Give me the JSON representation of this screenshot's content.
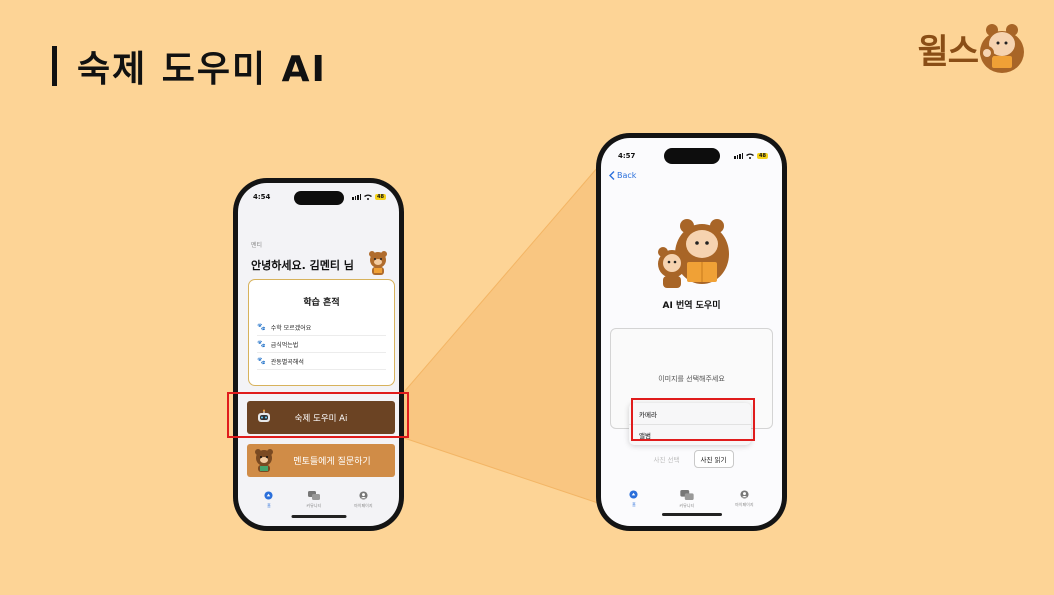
{
  "slide": {
    "title": "숙제 도우미 AI",
    "logo_text": "윌스"
  },
  "phone1": {
    "time": "4:54",
    "battery": "48",
    "greeting_sub": "멘티",
    "greeting": "안녕하세요. 김멘티 님",
    "history": {
      "title": "학습 흔적",
      "items": [
        "수학 모르겠어요",
        "급식먹는법",
        "관동별곡해석"
      ]
    },
    "homework_button": "숙제 도우미 Ai",
    "mentor_button": "멘토들에게 질문하기",
    "tabs": [
      "홈",
      "커뮤니티",
      "마이페이지"
    ]
  },
  "phone2": {
    "time": "4:57",
    "battery": "48",
    "back": "Back",
    "title": "AI 번역 도우미",
    "upload_prompt": "이미지를 선택해주세요",
    "menu": [
      "카메라",
      "앨범"
    ],
    "select_photo": "사진 선택",
    "read_photo": "사진 읽기",
    "tabs": [
      "홈",
      "커뮤니티",
      "마이페이지"
    ]
  },
  "colors": {
    "background": "#fdd496",
    "brand_brown": "#6b4323",
    "mentor_orange": "#d08c47",
    "highlight_red": "#e01c1c",
    "link_blue": "#2a6fdb"
  },
  "icons": [
    "signal-icon",
    "wifi-icon",
    "battery-icon",
    "paw-icon",
    "robot-icon",
    "bear-icon",
    "home-icon",
    "community-icon",
    "profile-icon",
    "chevron-left-icon"
  ]
}
